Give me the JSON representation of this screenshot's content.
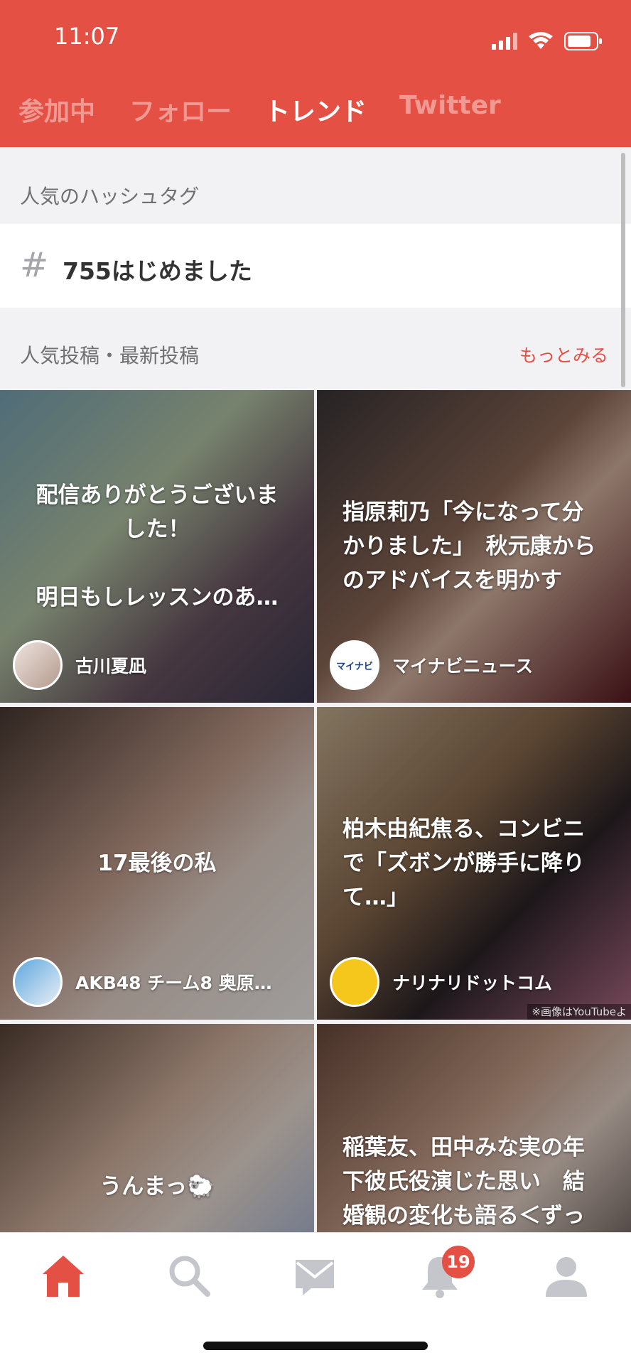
{
  "status_bar": {
    "time": "11:07"
  },
  "tabs": [
    {
      "label": "参加中",
      "active": false
    },
    {
      "label": "フォロー",
      "active": false
    },
    {
      "label": "トレンド",
      "active": true
    },
    {
      "label": "Twitter",
      "active": false
    }
  ],
  "hashtags": {
    "title": "人気のハッシュタグ",
    "items": [
      {
        "symbol": "#",
        "text": "755はじめました"
      }
    ]
  },
  "posts": {
    "title": "人気投稿・最新投稿",
    "more_label": "もっとみる",
    "items": [
      {
        "text": "配信ありがとうございました！\n\n明日もしレッスンのあ…",
        "author": "古川夏凪"
      },
      {
        "text": "指原莉乃「今になって分かりました」　秋元康からのアドバイスを明かす",
        "author": "マイナビニュース",
        "avatar_label": "マイナビ"
      },
      {
        "text": "17最後の私",
        "author": "AKB48 チーム8 奥原…"
      },
      {
        "text": "柏木由紀焦る、コンビニで「ズボンが勝手に降りて…」",
        "author": "ナリナリドットコム",
        "caption": "※画像はYouTubeよ"
      },
      {
        "text": "うんまっ🐑",
        "author": ""
      },
      {
        "text": "稲葉友、田中みな実の年下彼氏役演じた思い　結婚観の変化も語る＜ずっと独身でいるつもり？＞",
        "author": ""
      }
    ]
  },
  "tabbar": {
    "items": [
      "home-icon",
      "search-icon",
      "mail-icon",
      "bell-icon",
      "profile-icon"
    ],
    "notifications_badge": "19"
  },
  "colors": {
    "accent": "#e55045",
    "inactive_icon": "#c4c6cb"
  }
}
